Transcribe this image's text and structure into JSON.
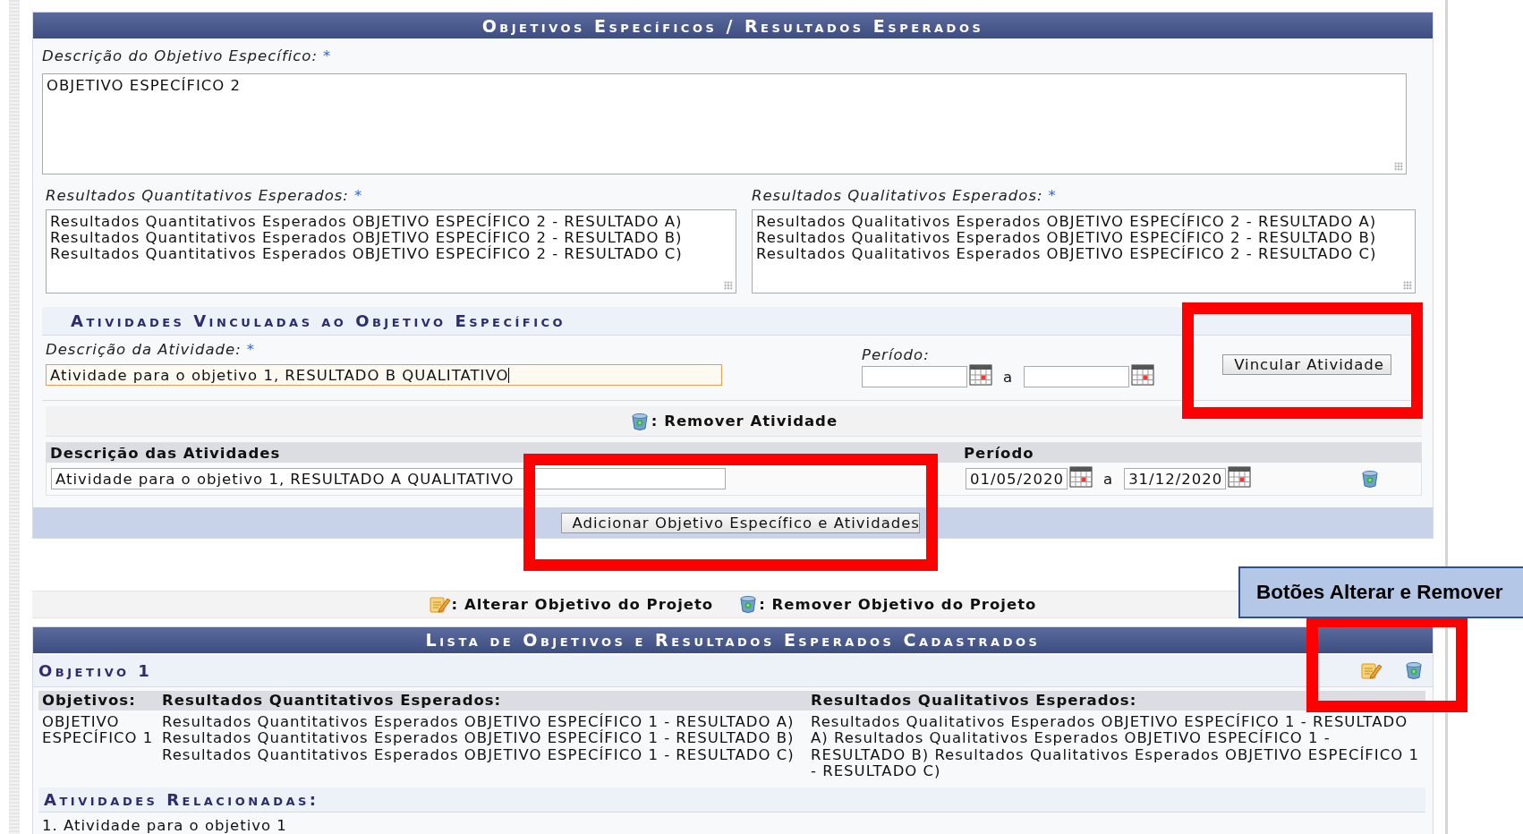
{
  "form_panel": {
    "title": "Objetivos Específicos / Resultados Esperados",
    "objective_field": {
      "label": "Descrição do Objetivo Específico:",
      "required_mark": "*",
      "value": "OBJETIVO ESPECÍFICO 2"
    },
    "quantitative_field": {
      "label": "Resultados Quantitativos Esperados:",
      "required_mark": "*",
      "value": "Resultados Quantitativos Esperados OBJETIVO ESPECÍFICO 2 - RESULTADO A)\nResultados Quantitativos Esperados OBJETIVO ESPECÍFICO 2 - RESULTADO B)\nResultados Quantitativos Esperados OBJETIVO ESPECÍFICO 2 - RESULTADO C)"
    },
    "qualitative_field": {
      "label": "Resultados Qualitativos Esperados:",
      "required_mark": "*",
      "value": "Resultados Qualitativos Esperados OBJETIVO ESPECÍFICO 2 - RESULTADO A)\nResultados Qualitativos Esperados OBJETIVO ESPECÍFICO 2 - RESULTADO B)\nResultados Qualitativos Esperados OBJETIVO ESPECÍFICO 2 - RESULTADO C)"
    },
    "activities_section": {
      "title": "Atividades Vinculadas ao Objetivo Específico",
      "description_field": {
        "label": "Descrição da Atividade:",
        "required_mark": "*",
        "value": "Atividade para o objetivo 1, RESULTADO B QUALITATIVO",
        "focused": true
      },
      "period": {
        "label": "Período:",
        "separator": "a"
      },
      "link_button": {
        "label": "Vincular Atividade",
        "framed": true
      }
    },
    "remove_legend": ": Remover Atividade",
    "activities_table": {
      "columns": [
        "Descrição das Atividades",
        "Período"
      ],
      "rows": [
        {
          "description": "Atividade para o objetivo 1, RESULTADO A QUALITATIVO",
          "start": "01/05/2020",
          "separator": "a",
          "end": "31/12/2020"
        }
      ]
    },
    "add_button": {
      "label": "Adicionar Objetivo Específico e Atividades",
      "framed": true
    }
  },
  "legend": [
    {
      "kind": "edit",
      "label": ": Alterar Objetivo do Projeto"
    },
    {
      "kind": "remove",
      "label": ": Remover Objetivo do Projeto"
    }
  ],
  "list_panel": {
    "title": "Lista de Objetivos e Resultados Esperados Cadastrados",
    "objectives": [
      {
        "title": "Objetivo 1",
        "actions_framed": true,
        "columns": [
          "Objetivos:",
          "Resultados Quantitativos Esperados:",
          "Resultados Qualitativos Esperados:"
        ],
        "objective": "OBJETIVO ESPECÍFICO 1",
        "quantitative": "Resultados Quantitativos Esperados OBJETIVO ESPECÍFICO 1 - RESULTADO A)\nResultados Quantitativos Esperados OBJETIVO ESPECÍFICO 1 - RESULTADO B)\nResultados Quantitativos Esperados OBJETIVO ESPECÍFICO 1 - RESULTADO C)",
        "qualitative": "Resultados Qualitativos Esperados OBJETIVO ESPECÍFICO 1 - RESULTADO A) Resultados Qualitativos Esperados OBJETIVO ESPECÍFICO 1 - RESULTADO B) Resultados Qualitativos Esperados OBJETIVO ESPECÍFICO 1 - RESULTADO C)",
        "activities_title": "Atividades Relacionadas:",
        "activities": [
          "1. Atividade para o objetivo 1"
        ]
      }
    ]
  },
  "annotations": {
    "callout": "Botões Alterar e Remover"
  }
}
